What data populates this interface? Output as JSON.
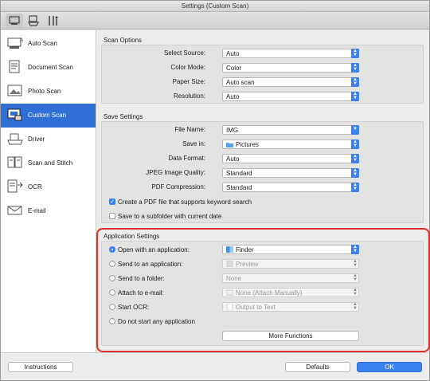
{
  "window": {
    "title": "Settings (Custom Scan)"
  },
  "toolbar": {
    "icons": [
      "scan-settings-icon",
      "scanner-pc-icon",
      "tools-icon"
    ]
  },
  "sidebar": {
    "items": [
      {
        "label": "Auto Scan",
        "icon": "auto-scan-icon"
      },
      {
        "label": "Document Scan",
        "icon": "document-scan-icon"
      },
      {
        "label": "Photo Scan",
        "icon": "photo-scan-icon"
      },
      {
        "label": "Custom Scan",
        "icon": "custom-scan-icon",
        "active": true
      },
      {
        "label": "Driver",
        "icon": "driver-icon"
      },
      {
        "label": "Scan and Stitch",
        "icon": "scan-stitch-icon"
      },
      {
        "label": "OCR",
        "icon": "ocr-icon"
      },
      {
        "label": "E-mail",
        "icon": "email-icon"
      }
    ]
  },
  "scan_options": {
    "title": "Scan Options",
    "select_source": {
      "label": "Select Source:",
      "value": "Auto"
    },
    "color_mode": {
      "label": "Color Mode:",
      "value": "Color"
    },
    "paper_size": {
      "label": "Paper Size:",
      "value": "Auto scan"
    },
    "resolution": {
      "label": "Resolution:",
      "value": "Auto"
    }
  },
  "save_settings": {
    "title": "Save Settings",
    "file_name": {
      "label": "File Name:",
      "value": "IMG"
    },
    "save_in": {
      "label": "Save in:",
      "value": "Pictures"
    },
    "data_format": {
      "label": "Data Format:",
      "value": "Auto"
    },
    "jpeg_quality": {
      "label": "JPEG Image Quality:",
      "value": "Standard"
    },
    "pdf_compression": {
      "label": "PDF Compression:",
      "value": "Standard"
    },
    "create_pdf": {
      "label": "Create a PDF file that supports keyword search",
      "checked": true
    },
    "save_subfolder": {
      "label": "Save to a subfolder with current date",
      "checked": false
    }
  },
  "app_settings": {
    "title": "Application Settings",
    "open_app": {
      "label": "Open with an application:",
      "value": "Finder",
      "checked": true
    },
    "send_app": {
      "label": "Send to an application:",
      "value": "Preview"
    },
    "send_folder": {
      "label": "Send to a folder:",
      "value": "None"
    },
    "attach_email": {
      "label": "Attach to e-mail:",
      "value": "None (Attach Manually)"
    },
    "start_ocr": {
      "label": "Start OCR:",
      "value": "Output to Text"
    },
    "no_app": {
      "label": "Do not start any application"
    },
    "more_functions": "More Functions"
  },
  "footer": {
    "instructions": "Instructions",
    "defaults": "Defaults",
    "ok": "OK"
  }
}
